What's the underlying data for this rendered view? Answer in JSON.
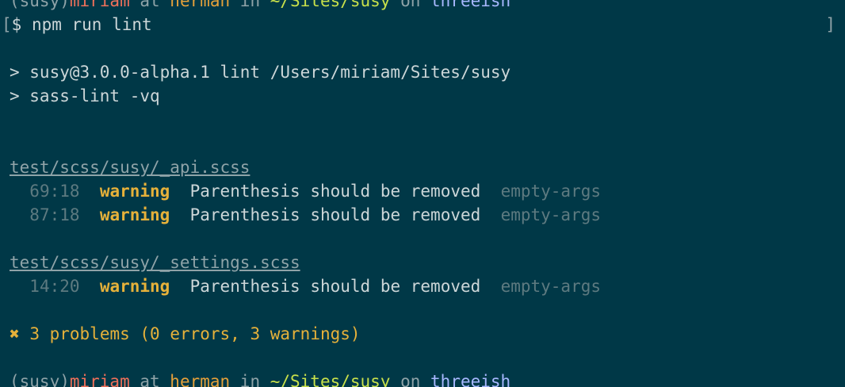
{
  "prompt": {
    "env": "(susy)",
    "user": "miriam",
    "at": " at ",
    "host": "herman",
    "in": " in ",
    "path": "~/Sites/susy",
    "on": " on ",
    "branch": "threeish"
  },
  "command_line": {
    "bracket_open": "[",
    "text": "$ npm run lint",
    "bracket_close": "]"
  },
  "script_output": [
    "> susy@3.0.0-alpha.1 lint /Users/miriam/Sites/susy",
    "> sass-lint -vq"
  ],
  "files": [
    {
      "name": "test/scss/susy/_api.scss",
      "issues": [
        {
          "loc": "69:18",
          "level": "warning",
          "message": "Parenthesis should be removed",
          "rule": "empty-args"
        },
        {
          "loc": "87:18",
          "level": "warning",
          "message": "Parenthesis should be removed",
          "rule": "empty-args"
        }
      ]
    },
    {
      "name": "test/scss/susy/_settings.scss",
      "issues": [
        {
          "loc": "14:20",
          "level": "warning",
          "message": "Parenthesis should be removed",
          "rule": "empty-args"
        }
      ]
    }
  ],
  "summary": {
    "icon": "cross-icon",
    "symbol": "✖",
    "text": "3 problems (0 errors, 3 warnings)"
  },
  "colors": {
    "background": "#003847",
    "user": "#f0705a",
    "host": "#e6a13a",
    "path": "#c8e04a",
    "branch": "#a8b8ff",
    "warning": "#e6b13a"
  }
}
